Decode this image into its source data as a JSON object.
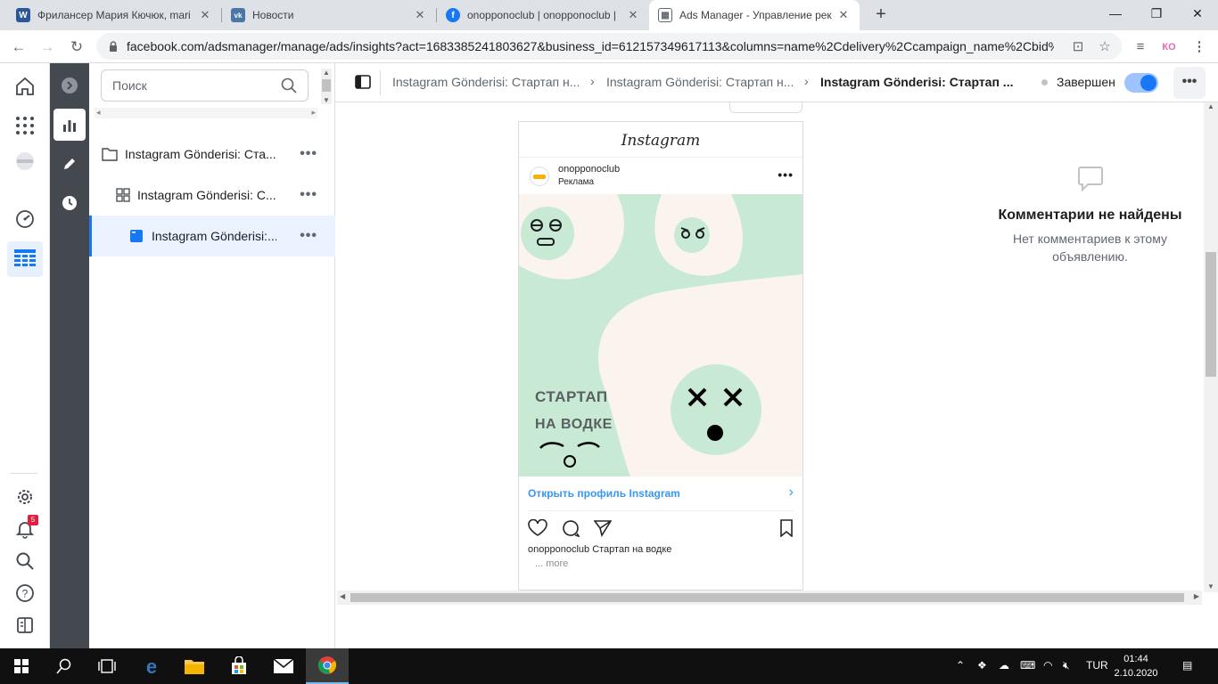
{
  "browser": {
    "tabs": [
      {
        "title": "Фрилансер Мария Кючюк, mari",
        "favicon": "W",
        "color": "#2b579a"
      },
      {
        "title": "Новости",
        "favicon": "vk",
        "color": "#4a76a8"
      },
      {
        "title": "onopponoclub | onopponoclub |",
        "favicon": "f",
        "color": "#1877f2"
      },
      {
        "title": "Ads Manager - Управление рек",
        "favicon": "ads",
        "color": "#606770"
      }
    ],
    "url": "facebook.com/adsmanager/manage/ads/insights?act=1683385241803627&business_id=612157349617113&columns=name%2Cdelivery%2Ccampaign_name%2Cbid%...",
    "profile_initials": "КО"
  },
  "global_nav": {
    "notification_count": "5"
  },
  "tree": {
    "search_placeholder": "Поиск",
    "rows": [
      {
        "label": "Instagram Gönderisi: Ста...",
        "type": "campaign"
      },
      {
        "label": "Instagram Gönderisi: С...",
        "type": "adset"
      },
      {
        "label": "Instagram Gönderisi:...",
        "type": "ad"
      }
    ]
  },
  "header": {
    "breadcrumbs": [
      "Instagram Gönderisi: Стартап н...",
      "Instagram Gönderisi: Стартап н...",
      "Instagram Gönderisi: Стартап ..."
    ],
    "status": "Завершен",
    "toggle_on": true
  },
  "preview": {
    "app_name": "Instagram",
    "username": "onopponoclub",
    "sponsored": "Реклама",
    "image_text_line1": "СТАРТАП",
    "image_text_line2": "НА ВОДКЕ",
    "cta": "Открыть профиль Instagram",
    "caption_user": "onopponoclub",
    "caption_text": "Стартап на водке",
    "more": "... more",
    "colors": {
      "mint": "#c8ead4",
      "cream": "#faf3ee",
      "link": "#3897f0"
    }
  },
  "comments": {
    "title": "Комментарии не найдены",
    "subtitle": "Нет комментариев к этому объявлению."
  },
  "taskbar": {
    "language": "TUR",
    "time": "01:44",
    "date": "2.10.2020"
  }
}
